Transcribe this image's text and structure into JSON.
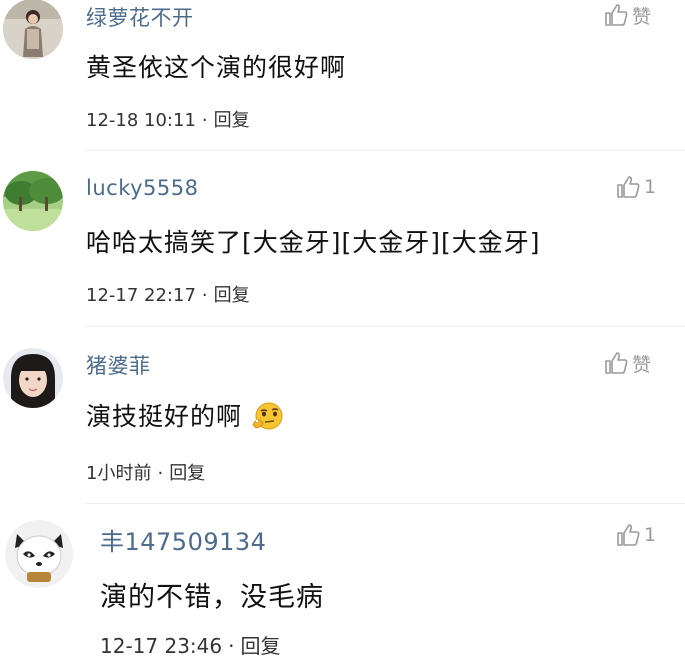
{
  "comments": [
    {
      "username": "绿萝花不开",
      "content": "黄圣依这个演的很好啊",
      "time": "12-18 10:11",
      "reply_label": "回复",
      "like_label": "赞",
      "avatar_icon": "woman-portrait-avatar"
    },
    {
      "username": "lucky5558",
      "content": "哈哈太搞笑了[大金牙][大金牙][大金牙]",
      "time": "12-17 22:17",
      "reply_label": "回复",
      "like_label": "1",
      "avatar_icon": "green-trees-avatar"
    },
    {
      "username": "猪婆菲",
      "content": "演技挺好的啊",
      "content_emoji": "thinking-face-emoji",
      "time": "1小时前",
      "reply_label": "回复",
      "like_label": "赞",
      "avatar_icon": "girl-portrait-avatar"
    },
    {
      "username": "丰147509134",
      "content": "演的不错，没毛病",
      "time": "12-17 23:46",
      "reply_label": "回复",
      "like_label": "1",
      "avatar_icon": "panda-cartoon-avatar"
    }
  ],
  "separator": "·",
  "like_icon": "thumbs-up-icon"
}
